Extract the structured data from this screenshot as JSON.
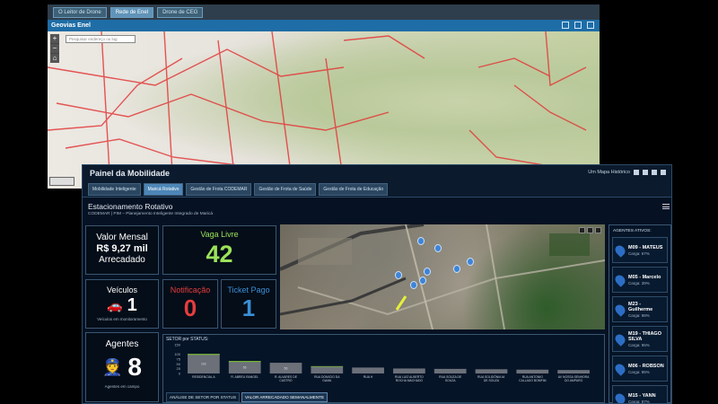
{
  "window_back": {
    "tabs": [
      "O Leitor de Drone",
      "Rede de Enel",
      "Drone de CEG"
    ],
    "active_tab": 1,
    "title": "Geovias Enel",
    "search_placeholder": "Pesquisar endereço ou lug"
  },
  "window_front": {
    "app_title": "Painel da Mobilidade",
    "top_right_text": "Um Mapa Histórico",
    "nav": [
      "Mobilidade Inteligente",
      "Maricá Rotativo",
      "Gestão de Frota CODEMAR",
      "Gestão de Frota de Saúde",
      "Gestão de Frota de Educação"
    ],
    "active_nav": 1,
    "section_title": "Estacionamento Rotativo",
    "section_subtitle": "CODEMAR | PIM – Planejamento Inteligente Integrado de Maricá"
  },
  "kpis": {
    "valor_mensal_label": "Valor Mensal",
    "valor_mensal_value": "R$ 9,27 mil",
    "valor_mensal_sub": "Arrecadado",
    "vaga_livre_label": "Vaga Livre",
    "vaga_livre_value": "42",
    "veiculos_label": "Veículos",
    "veiculos_value": "1",
    "veiculos_sub": "Veículos em monitoramento",
    "notificacao_label": "Notificação",
    "notificacao_value": "0",
    "ticket_label": "Ticket Pago",
    "ticket_value": "1",
    "agentes_label": "Agentes",
    "agentes_value": "8",
    "agentes_sub": "Agentes em campo"
  },
  "agents_panel": {
    "title": "AGENTES ATIVOS:",
    "items": [
      {
        "name": "M09 - MATEUS",
        "cargo": "Carga: 67%"
      },
      {
        "name": "M05 - Marcelo",
        "cargo": "Carga: 39%"
      },
      {
        "name": "M23 - Guilherme",
        "cargo": "Carga: 98%"
      },
      {
        "name": "M19 - THIAGO SILVA",
        "cargo": "Carga: 95%"
      },
      {
        "name": "M06 - ROBSON",
        "cargo": "Carga: 95%"
      },
      {
        "name": "M15 - YANN",
        "cargo": "Carga: 87%"
      }
    ]
  },
  "chart_panel": {
    "title": "SETOR por STATUS:",
    "tabs": [
      "ANÁLISE DE SETOR POR STATUS",
      "VALOR ARRECADADO SEMANALMENTE"
    ],
    "active_tab": 1
  },
  "chart_data": {
    "type": "bar",
    "categories": [
      "RESIDENCIAL A",
      "R. ABREU RANGEL",
      "R. ALVARES DE CASTRO",
      "RUA DOMICIO DA GAMA",
      "RUA H",
      "RUA LUIZ ALBERTO ROCHA MACHADO",
      "RUA SOUZA DE SOUZA",
      "RUA SOLIDÔNIA M. DE SOUZA",
      "RUA ANTONIO CALLADO BOMFIM",
      "AV NOSSA SENHORA DO AMPARO"
    ],
    "values": [
      102,
      65,
      56,
      38,
      31,
      26,
      24,
      22,
      20,
      18
    ],
    "highlight_values": [
      5,
      5,
      0,
      3,
      0,
      0,
      0,
      0,
      0,
      0
    ],
    "value_labels": [
      "102",
      "65",
      "56",
      "",
      "",
      "",
      "",
      "",
      "",
      ""
    ],
    "ylim": [
      0,
      150
    ],
    "yticks": [
      0,
      25,
      50,
      75,
      100,
      150
    ],
    "colors": {
      "bar": "#6b7079",
      "highlight": "#7ac22e"
    }
  }
}
